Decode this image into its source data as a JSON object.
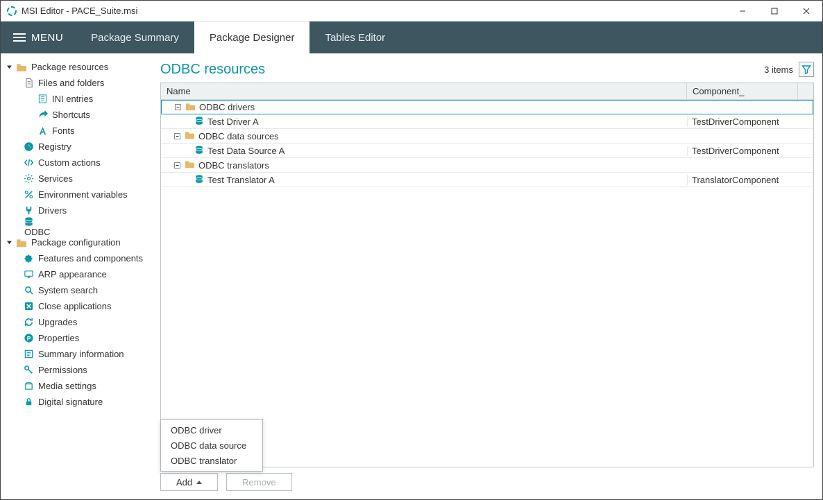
{
  "window": {
    "title": "MSI Editor - PACE_Suite.msi"
  },
  "topbar": {
    "menu_label": "MENU",
    "tabs": [
      {
        "label": "Package Summary",
        "active": false
      },
      {
        "label": "Package Designer",
        "active": true
      },
      {
        "label": "Tables Editor",
        "active": false
      }
    ]
  },
  "sidebar": {
    "groups": [
      {
        "label": "Package resources",
        "expanded": true,
        "items": [
          {
            "label": "Files and folders",
            "icon": "file",
            "children": [
              {
                "label": "INI entries",
                "icon": "ini"
              },
              {
                "label": "Shortcuts",
                "icon": "shortcut"
              },
              {
                "label": "Fonts",
                "icon": "font"
              }
            ]
          },
          {
            "label": "Registry",
            "icon": "registry"
          },
          {
            "label": "Custom actions",
            "icon": "code"
          },
          {
            "label": "Services",
            "icon": "gear"
          },
          {
            "label": "Environment variables",
            "icon": "percent"
          },
          {
            "label": "Drivers",
            "icon": "plug"
          },
          {
            "label": "ODBC",
            "icon": "db",
            "selected": true
          }
        ]
      },
      {
        "label": "Package configuration",
        "expanded": true,
        "items": [
          {
            "label": "Features and components",
            "icon": "puzzle"
          },
          {
            "label": "ARP appearance",
            "icon": "monitor"
          },
          {
            "label": "System search",
            "icon": "search"
          },
          {
            "label": "Close applications",
            "icon": "close"
          },
          {
            "label": "Upgrades",
            "icon": "refresh"
          },
          {
            "label": "Properties",
            "icon": "p"
          },
          {
            "label": "Summary information",
            "icon": "summary"
          },
          {
            "label": "Permissions",
            "icon": "key"
          },
          {
            "label": "Media settings",
            "icon": "media"
          },
          {
            "label": "Digital signature",
            "icon": "lock"
          }
        ]
      }
    ]
  },
  "main": {
    "title": "ODBC resources",
    "count_text": "3 items",
    "columns": {
      "name": "Name",
      "component": "Component_"
    },
    "rows": [
      {
        "type": "group",
        "label": "ODBC drivers",
        "selected": true
      },
      {
        "type": "item",
        "label": "Test Driver A",
        "component": "TestDriverComponent"
      },
      {
        "type": "group",
        "label": "ODBC data sources"
      },
      {
        "type": "item",
        "label": "Test Data Source A",
        "component": "TestDriverComponent"
      },
      {
        "type": "group",
        "label": "ODBC translators"
      },
      {
        "type": "item",
        "label": "Test Translator A",
        "component": "TranslatorComponent"
      }
    ],
    "add_menu": [
      {
        "label": "ODBC driver"
      },
      {
        "label": "ODBC data source"
      },
      {
        "label": "ODBC translator"
      }
    ],
    "buttons": {
      "add": "Add",
      "remove": "Remove"
    }
  }
}
